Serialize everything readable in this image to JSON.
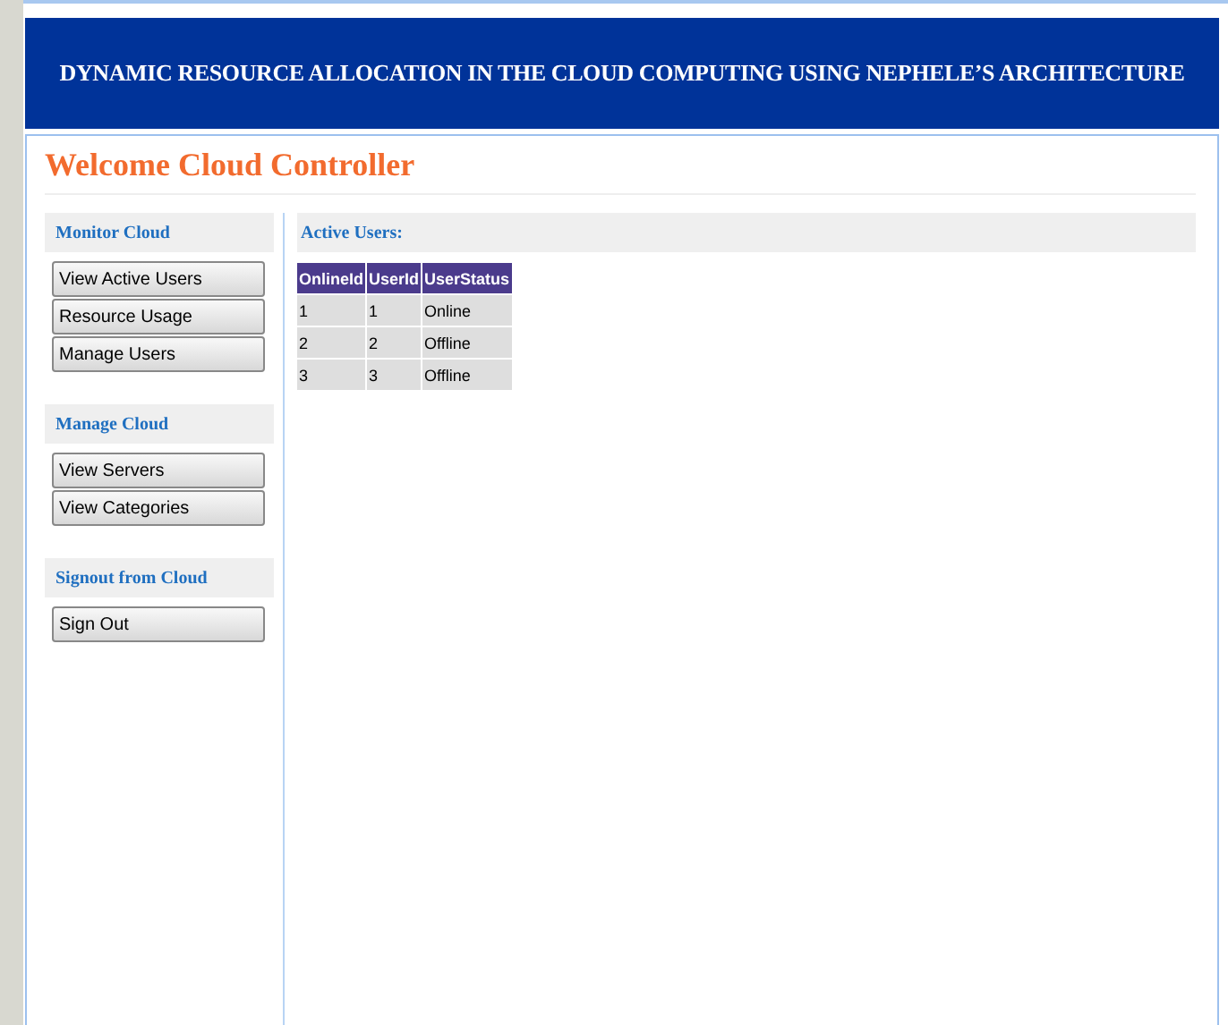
{
  "header": {
    "title": "DYNAMIC RESOURCE ALLOCATION IN THE CLOUD COMPUTING USING NEPHELE’S ARCHITECTURE"
  },
  "welcome": "Welcome Cloud Controller",
  "sidebar": [
    {
      "heading": "Monitor Cloud",
      "buttons": [
        "View Active Users",
        "Resource Usage",
        "Manage Users"
      ]
    },
    {
      "heading": "Manage Cloud",
      "buttons": [
        "View Servers",
        "View Categories"
      ]
    },
    {
      "heading": "Signout from Cloud",
      "buttons": [
        "Sign Out"
      ]
    }
  ],
  "content": {
    "heading": "Active Users:",
    "table": {
      "columns": [
        "OnlineId",
        "UserId",
        "UserStatus"
      ],
      "rows": [
        [
          "1",
          "1",
          "Online"
        ],
        [
          "2",
          "2",
          "Offline"
        ],
        [
          "3",
          "3",
          "Offline"
        ]
      ]
    }
  }
}
